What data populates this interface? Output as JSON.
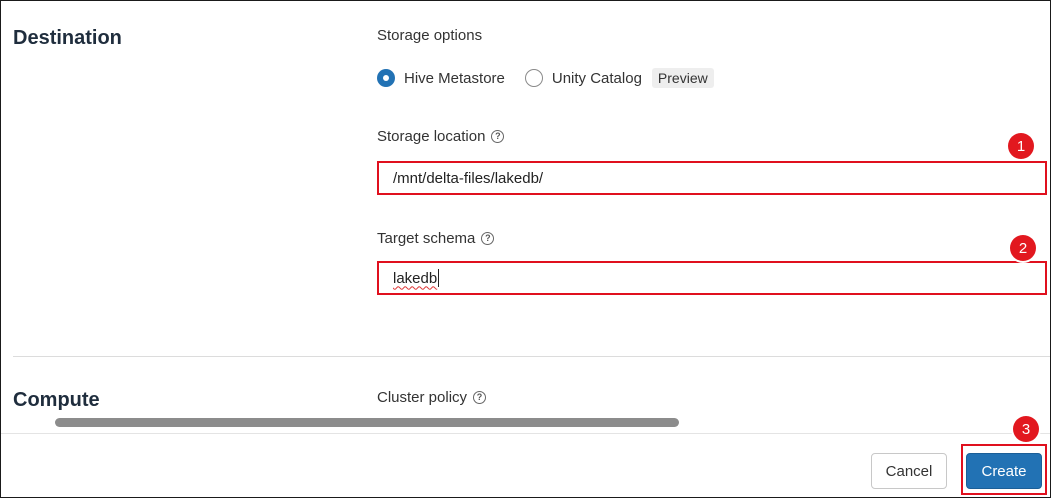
{
  "destination": {
    "title": "Destination",
    "storage_options": {
      "label": "Storage options",
      "options": [
        {
          "label": "Hive Metastore",
          "checked": true
        },
        {
          "label": "Unity Catalog",
          "checked": false
        }
      ],
      "preview_badge": "Preview"
    },
    "storage_location": {
      "label": "Storage location",
      "help": "?",
      "value": "/mnt/delta-files/lakedb/"
    },
    "target_schema": {
      "label": "Target schema",
      "help": "?",
      "value": "lakedb"
    }
  },
  "compute": {
    "title": "Compute",
    "cluster_policy": {
      "label": "Cluster policy",
      "help": "?"
    }
  },
  "footer": {
    "cancel_label": "Cancel",
    "create_label": "Create"
  },
  "callouts": [
    "1",
    "2",
    "3"
  ],
  "colors": {
    "accent": "#2272b4",
    "highlight": "#e0101e",
    "callout": "#e2181f"
  }
}
